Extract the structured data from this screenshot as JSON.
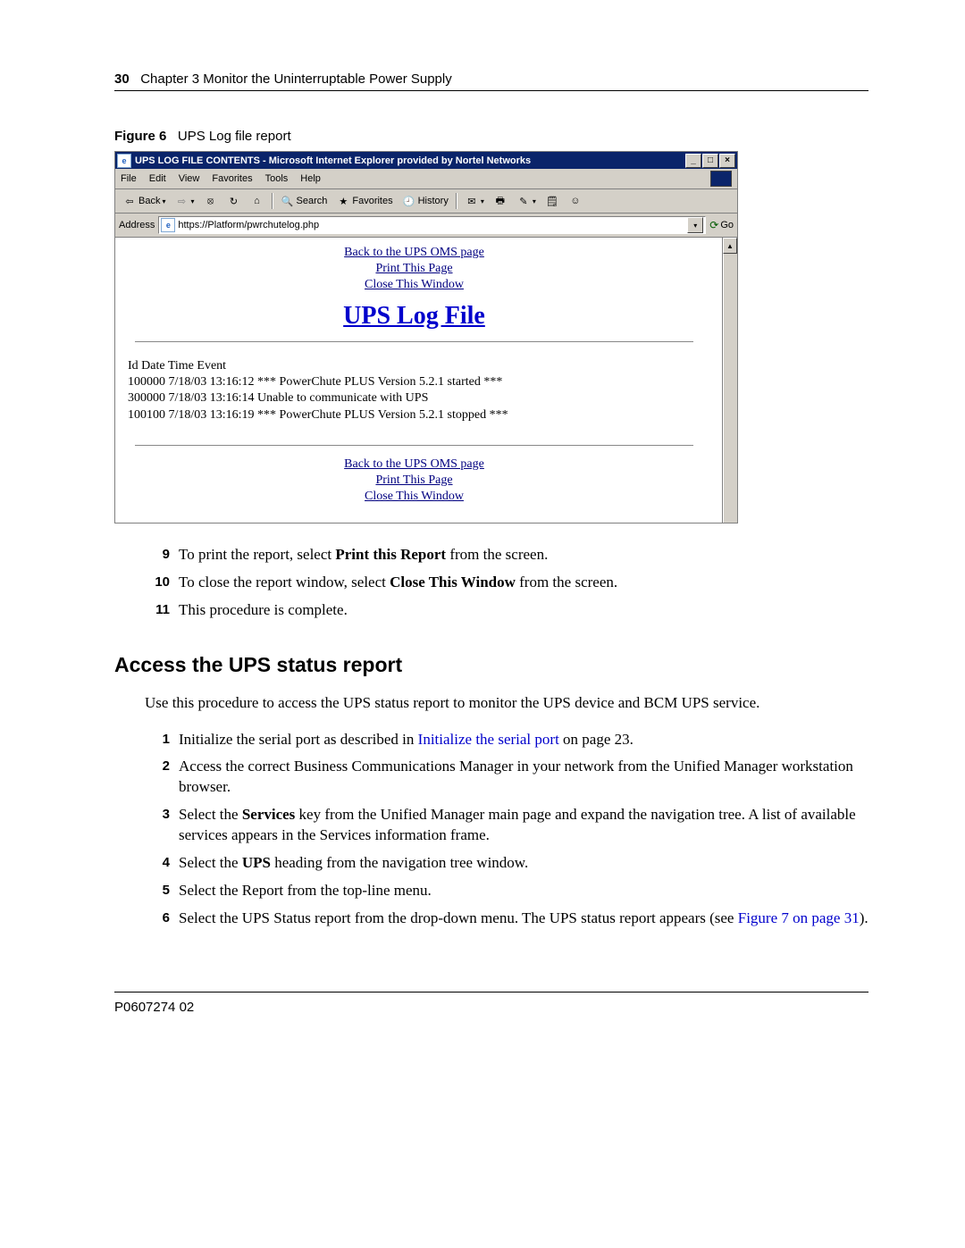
{
  "header": {
    "page_number": "30",
    "chapter_text": "Chapter 3  Monitor the Uninterruptable Power Supply"
  },
  "figure": {
    "label": "Figure 6",
    "caption": "UPS Log file report"
  },
  "ie": {
    "title": "UPS LOG FILE CONTENTS - Microsoft Internet Explorer provided by Nortel Networks",
    "menu": {
      "file": "File",
      "edit": "Edit",
      "view": "View",
      "favorites": "Favorites",
      "tools": "Tools",
      "help": "Help"
    },
    "toolbar": {
      "back": "Back",
      "search": "Search",
      "favorites": "Favorites",
      "history": "History"
    },
    "address_label": "Address",
    "url": "https://Platform/pwrchutelog.php",
    "go": "Go",
    "links": {
      "back": "Back to the UPS OMS page",
      "print": "Print This Page",
      "close": "Close This Window"
    },
    "page_title": "UPS Log File",
    "log_header": "Id Date Time Event",
    "log_line1": "100000 7/18/03 13:16:12 *** PowerChute PLUS Version 5.2.1 started ***",
    "log_line2": "300000 7/18/03 13:16:14 Unable to communicate with UPS",
    "log_line3": "100100 7/18/03 13:16:19 *** PowerChute PLUS Version 5.2.1 stopped ***"
  },
  "steps_a": {
    "s9": {
      "n": "9",
      "pre": "To print the report, select ",
      "b": "Print this Report",
      "post": " from the screen."
    },
    "s10": {
      "n": "10",
      "pre": "To close the report window, select ",
      "b": "Close This Window",
      "post": " from the screen."
    },
    "s11": {
      "n": "11",
      "txt": "This procedure is complete."
    }
  },
  "section_heading": "Access the UPS status report",
  "intro": "Use this procedure to access the UPS status report to monitor the UPS device and BCM UPS service.",
  "steps_b": {
    "s1": {
      "n": "1",
      "pre": "Initialize the serial port as described in ",
      "link": "Initialize the serial port",
      "post": " on page 23."
    },
    "s2": {
      "n": "2",
      "txt": "Access the correct Business Communications Manager in your network from the Unified Manager workstation browser."
    },
    "s3": {
      "n": "3",
      "pre": "Select the ",
      "b": "Services",
      "post": " key from the Unified Manager main page and expand the navigation tree. A list of available services appears in the Services information frame."
    },
    "s4": {
      "n": "4",
      "pre": "Select the ",
      "b": "UPS",
      "post": " heading from the navigation tree window."
    },
    "s5": {
      "n": "5",
      "txt": "Select the Report from the top-line menu."
    },
    "s6": {
      "n": "6",
      "pre": "Select the UPS Status report from the drop-down menu. The UPS status report appears (see ",
      "link": "Figure 7 on page 31",
      "post": ")."
    }
  },
  "footer": "P0607274   02"
}
